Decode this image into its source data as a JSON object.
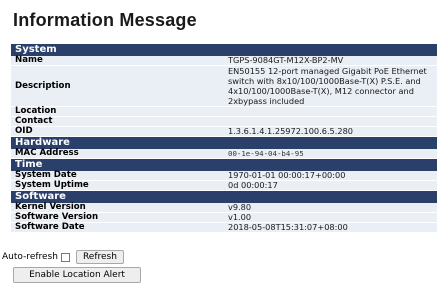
{
  "page": {
    "title": "Information Message"
  },
  "sections": [
    {
      "header": "System",
      "rows": [
        {
          "key": "Name",
          "value": "TGPS-9084GT-M12X-BP2-MV"
        },
        {
          "key": "Description",
          "value": "EN50155 12-port managed Gigabit PoE Ethernet switch with 8x10/100/1000Base-T(X) P.S.E. and 4x10/100/1000Base-T(X), M12 connector and 2xbypass included"
        },
        {
          "key": "Location",
          "value": ""
        },
        {
          "key": "Contact",
          "value": ""
        },
        {
          "key": "OID",
          "value": "1.3.6.1.4.1.25972.100.6.5.280"
        }
      ]
    },
    {
      "header": "Hardware",
      "rows": [
        {
          "key": "MAC Address",
          "value": "00-1e-94-04-b4-95"
        }
      ]
    },
    {
      "header": "Time",
      "rows": [
        {
          "key": "System Date",
          "value": "1970-01-01 00:00:17+00:00"
        },
        {
          "key": "System Uptime",
          "value": "0d 00:00:17"
        }
      ]
    },
    {
      "header": "Software",
      "rows": [
        {
          "key": "Kernel Version",
          "value": "v9.80"
        },
        {
          "key": "Software Version",
          "value": "v1.00"
        },
        {
          "key": "Software Date",
          "value": "2018-05-08T15:31:07+08:00"
        }
      ]
    }
  ],
  "controls": {
    "auto_refresh_label": "Auto-refresh",
    "auto_refresh_checked": false,
    "refresh_label": "Refresh",
    "location_alert_label": "Enable Location Alert"
  }
}
